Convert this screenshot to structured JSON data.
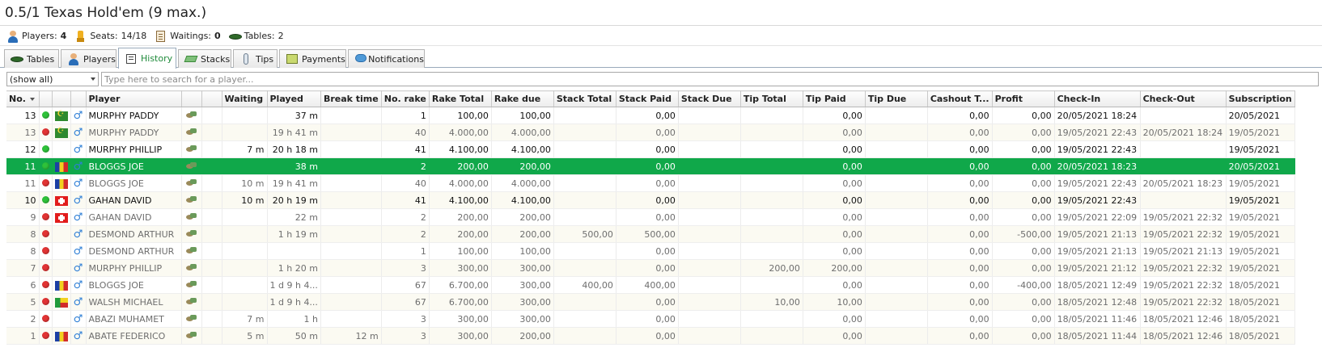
{
  "title": "0.5/1 Texas Hold'em (9 max.)",
  "stats": [
    {
      "icon": "player-icon",
      "label": "Players:",
      "value": "4"
    },
    {
      "icon": "seat-icon",
      "label": "Seats:",
      "value": "14/18"
    },
    {
      "icon": "waiting-icon",
      "label": "Waitings:",
      "value": "0"
    },
    {
      "icon": "table-icon",
      "label": "Tables:",
      "value": "2"
    }
  ],
  "tabs": [
    {
      "label": "Tables",
      "icon": "table-icon",
      "active": false
    },
    {
      "label": "Players",
      "icon": "player-icon",
      "active": false
    },
    {
      "label": "History",
      "icon": "history-icon",
      "active": true
    },
    {
      "label": "Stacks",
      "icon": "stacks-icon",
      "active": false
    },
    {
      "label": "Tips",
      "icon": "tips-icon",
      "active": false
    },
    {
      "label": "Payments",
      "icon": "payments-icon",
      "active": false
    },
    {
      "label": "Notifications",
      "icon": "notifications-icon",
      "active": false
    }
  ],
  "filter": {
    "select_value": "(show all)",
    "search_placeholder": "Type here to search for a player..."
  },
  "columns": [
    "No.",
    "",
    "",
    "",
    "Player",
    "",
    "",
    "Waiting",
    "Played",
    "Break time",
    "No. rake",
    "Rake Total",
    "Rake due",
    "Stack Total",
    "Stack Paid",
    "Stack Due",
    "Tip Total",
    "Tip Paid",
    "Tip Due",
    "Cashout T...",
    "Profit",
    "Check-In",
    "Check-Out",
    "Subscription"
  ],
  "colors": {
    "selected_row": "#10a84a",
    "active_tab": "#1f8a3a",
    "status_green": "#2fc23a",
    "status_red": "#e23434"
  },
  "rows": [
    {
      "no": "13",
      "status": "green",
      "flag": "mauritania",
      "player": "MURPHY PADDY",
      "waiting": "",
      "played": "37 m",
      "break": "",
      "rake_no": "1",
      "rake_total": "100,00",
      "rake_due": "100,00",
      "stack_total": "",
      "stack_paid": "0,00",
      "stack_due": "",
      "tip_total": "",
      "tip_paid": "0,00",
      "tip_due": "",
      "cashout": "0,00",
      "profit": "0,00",
      "checkin": "20/05/2021 18:24",
      "checkout": "",
      "subscription": "20/05/2021"
    },
    {
      "no": "13",
      "status": "red",
      "flag": "mauritania",
      "player": "MURPHY PADDY",
      "waiting": "",
      "played": "19 h 41 m",
      "break": "",
      "rake_no": "40",
      "rake_total": "4.000,00",
      "rake_due": "4.000,00",
      "stack_total": "",
      "stack_paid": "0,00",
      "stack_due": "",
      "tip_total": "",
      "tip_paid": "0,00",
      "tip_due": "",
      "cashout": "0,00",
      "profit": "0,00",
      "checkin": "19/05/2021 22:43",
      "checkout": "20/05/2021 18:24",
      "subscription": "19/05/2021"
    },
    {
      "no": "12",
      "status": "green",
      "flag": "",
      "player": "MURPHY PHILLIP",
      "waiting": "7 m",
      "played": "20 h 18 m",
      "break": "",
      "rake_no": "41",
      "rake_total": "4.100,00",
      "rake_due": "4.100,00",
      "stack_total": "",
      "stack_paid": "0,00",
      "stack_due": "",
      "tip_total": "",
      "tip_paid": "0,00",
      "tip_due": "",
      "cashout": "0,00",
      "profit": "0,00",
      "checkin": "19/05/2021 22:43",
      "checkout": "",
      "subscription": "19/05/2021"
    },
    {
      "no": "11",
      "status": "green",
      "flag": "romania",
      "player": "BLOGGS JOE",
      "waiting": "",
      "played": "38 m",
      "break": "",
      "rake_no": "2",
      "rake_total": "200,00",
      "rake_due": "200,00",
      "stack_total": "",
      "stack_paid": "0,00",
      "stack_due": "",
      "tip_total": "",
      "tip_paid": "0,00",
      "tip_due": "",
      "cashout": "0,00",
      "profit": "0,00",
      "checkin": "20/05/2021 18:23",
      "checkout": "",
      "subscription": "20/05/2021",
      "selected": true
    },
    {
      "no": "11",
      "status": "red",
      "flag": "romania",
      "player": "BLOGGS JOE",
      "waiting": "10 m",
      "played": "19 h 41 m",
      "break": "",
      "rake_no": "40",
      "rake_total": "4.000,00",
      "rake_due": "4.000,00",
      "stack_total": "",
      "stack_paid": "0,00",
      "stack_due": "",
      "tip_total": "",
      "tip_paid": "0,00",
      "tip_due": "",
      "cashout": "0,00",
      "profit": "0,00",
      "checkin": "19/05/2021 22:43",
      "checkout": "20/05/2021 18:23",
      "subscription": "19/05/2021"
    },
    {
      "no": "10",
      "status": "green",
      "flag": "switzerland",
      "player": "GAHAN DAVID",
      "waiting": "10 m",
      "played": "20 h 19 m",
      "break": "",
      "rake_no": "41",
      "rake_total": "4.100,00",
      "rake_due": "4.100,00",
      "stack_total": "",
      "stack_paid": "0,00",
      "stack_due": "",
      "tip_total": "",
      "tip_paid": "0,00",
      "tip_due": "",
      "cashout": "0,00",
      "profit": "0,00",
      "checkin": "19/05/2021 22:43",
      "checkout": "",
      "subscription": "19/05/2021"
    },
    {
      "no": "9",
      "status": "red",
      "flag": "switzerland",
      "player": "GAHAN DAVID",
      "waiting": "",
      "played": "22 m",
      "break": "",
      "rake_no": "2",
      "rake_total": "200,00",
      "rake_due": "200,00",
      "stack_total": "",
      "stack_paid": "0,00",
      "stack_due": "",
      "tip_total": "",
      "tip_paid": "0,00",
      "tip_due": "",
      "cashout": "0,00",
      "profit": "0,00",
      "checkin": "19/05/2021 22:09",
      "checkout": "19/05/2021 22:32",
      "subscription": "19/05/2021"
    },
    {
      "no": "8",
      "status": "red",
      "flag": "",
      "player": "DESMOND ARTHUR",
      "waiting": "",
      "played": "1 h 19 m",
      "break": "",
      "rake_no": "2",
      "rake_total": "200,00",
      "rake_due": "200,00",
      "stack_total": "500,00",
      "stack_paid": "500,00",
      "stack_due": "",
      "tip_total": "",
      "tip_paid": "0,00",
      "tip_due": "",
      "cashout": "0,00",
      "profit": "-500,00",
      "checkin": "19/05/2021 21:13",
      "checkout": "19/05/2021 22:32",
      "subscription": "19/05/2021"
    },
    {
      "no": "8",
      "status": "red",
      "flag": "",
      "player": "DESMOND ARTHUR",
      "waiting": "",
      "played": "",
      "break": "",
      "rake_no": "1",
      "rake_total": "100,00",
      "rake_due": "100,00",
      "stack_total": "",
      "stack_paid": "0,00",
      "stack_due": "",
      "tip_total": "",
      "tip_paid": "0,00",
      "tip_due": "",
      "cashout": "0,00",
      "profit": "0,00",
      "checkin": "19/05/2021 21:13",
      "checkout": "19/05/2021 21:13",
      "subscription": "19/05/2021"
    },
    {
      "no": "7",
      "status": "red",
      "flag": "",
      "player": "MURPHY PHILLIP",
      "waiting": "",
      "played": "1 h 20 m",
      "break": "",
      "rake_no": "3",
      "rake_total": "300,00",
      "rake_due": "300,00",
      "stack_total": "",
      "stack_paid": "0,00",
      "stack_due": "",
      "tip_total": "200,00",
      "tip_paid": "200,00",
      "tip_due": "",
      "cashout": "0,00",
      "profit": "0,00",
      "checkin": "19/05/2021 21:12",
      "checkout": "19/05/2021 22:32",
      "subscription": "19/05/2021"
    },
    {
      "no": "6",
      "status": "red",
      "flag": "romania",
      "player": "BLOGGS JOE",
      "waiting": "",
      "played": "1 d 9 h 4...",
      "break": "",
      "rake_no": "67",
      "rake_total": "6.700,00",
      "rake_due": "300,00",
      "stack_total": "400,00",
      "stack_paid": "400,00",
      "stack_due": "",
      "tip_total": "",
      "tip_paid": "0,00",
      "tip_due": "",
      "cashout": "0,00",
      "profit": "-400,00",
      "checkin": "18/05/2021 12:49",
      "checkout": "19/05/2021 22:32",
      "subscription": "18/05/2021"
    },
    {
      "no": "5",
      "status": "red",
      "flag": "benin",
      "player": "WALSH MICHAEL",
      "waiting": "",
      "played": "1 d 9 h 4...",
      "break": "",
      "rake_no": "67",
      "rake_total": "6.700,00",
      "rake_due": "300,00",
      "stack_total": "",
      "stack_paid": "0,00",
      "stack_due": "",
      "tip_total": "10,00",
      "tip_paid": "10,00",
      "tip_due": "",
      "cashout": "0,00",
      "profit": "0,00",
      "checkin": "18/05/2021 12:48",
      "checkout": "19/05/2021 22:32",
      "subscription": "18/05/2021"
    },
    {
      "no": "2",
      "status": "red",
      "flag": "",
      "player": "ABAZI MUHAMET",
      "waiting": "7 m",
      "played": "1 h",
      "break": "",
      "rake_no": "3",
      "rake_total": "300,00",
      "rake_due": "300,00",
      "stack_total": "",
      "stack_paid": "0,00",
      "stack_due": "",
      "tip_total": "",
      "tip_paid": "0,00",
      "tip_due": "",
      "cashout": "0,00",
      "profit": "0,00",
      "checkin": "18/05/2021 11:46",
      "checkout": "18/05/2021 12:46",
      "subscription": "18/05/2021"
    },
    {
      "no": "1",
      "status": "red",
      "flag": "romania",
      "player": "ABATE FEDERICO",
      "waiting": "5 m",
      "played": "50 m",
      "break": "12 m",
      "rake_no": "3",
      "rake_total": "300,00",
      "rake_due": "200,00",
      "stack_total": "",
      "stack_paid": "0,00",
      "stack_due": "",
      "tip_total": "",
      "tip_paid": "0,00",
      "tip_due": "",
      "cashout": "0,00",
      "profit": "0,00",
      "checkin": "18/05/2021 11:44",
      "checkout": "18/05/2021 12:46",
      "subscription": "18/05/2021"
    }
  ]
}
